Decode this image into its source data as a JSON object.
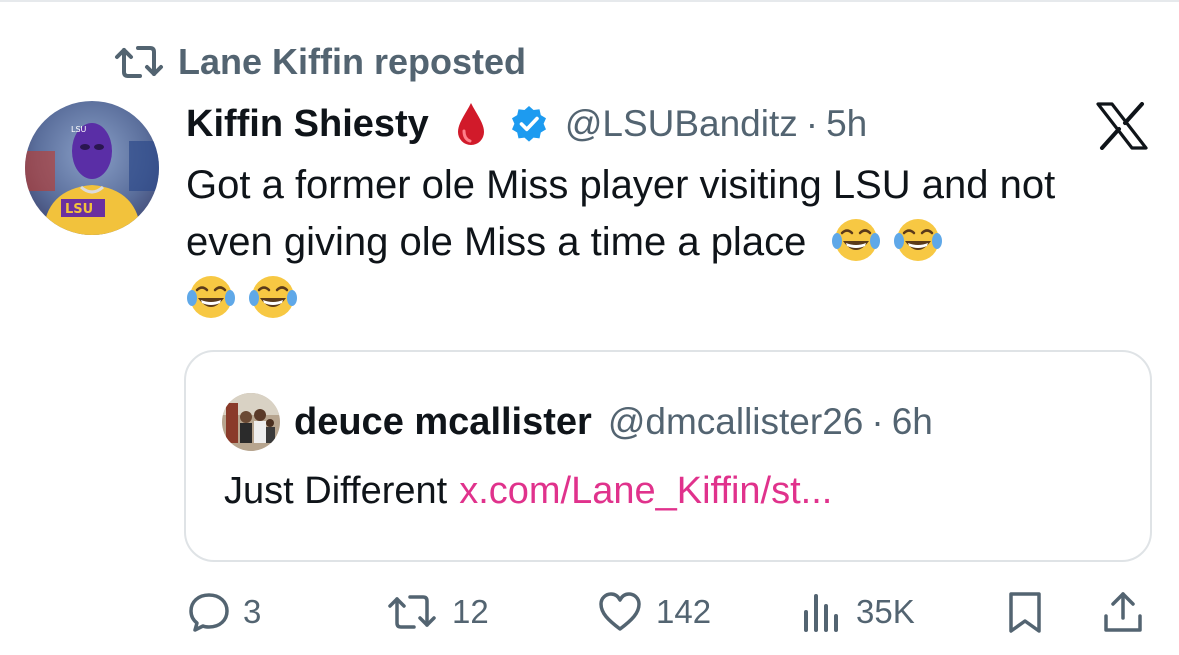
{
  "repost": {
    "text": "Lane Kiffin reposted"
  },
  "tweet": {
    "author_name": "Kiffin Shiesty",
    "handle": "@LSUBanditz",
    "separator": "·",
    "time": "5h",
    "text": "Got a former ole Miss player visiting LSU and not even giving ole Miss a time a place",
    "trailing_emojis": [
      "tears-of-joy",
      "tears-of-joy",
      "tears-of-joy",
      "tears-of-joy"
    ],
    "badge_icons": [
      "blood-drop-icon",
      "verified-badge-icon"
    ]
  },
  "quote": {
    "author_name": "deuce mcallister",
    "handle": "@dmcallister26",
    "separator": "·",
    "time": "6h",
    "text": "Just Different",
    "link": "x.com/Lane_Kiffin/st..."
  },
  "actions": {
    "replies": "3",
    "reposts": "12",
    "likes": "142",
    "views": "35K"
  },
  "colors": {
    "text": "#0f1419",
    "secondary": "#536471",
    "verified": "#1d9bf0",
    "link": "#e0328c",
    "border": "#dfe3e6"
  }
}
